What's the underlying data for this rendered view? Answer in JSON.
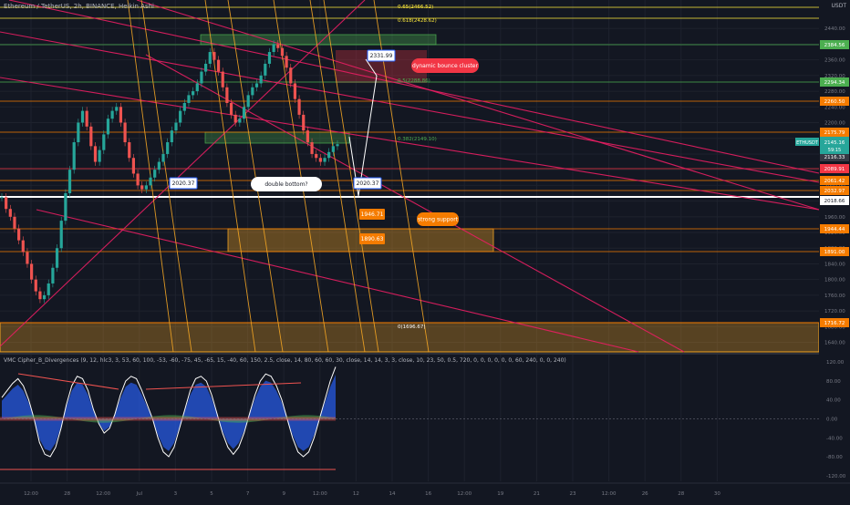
{
  "header": {
    "symbol_line": "Ethereum / TetherUS, 2h, BINANCE, Heikin Ashi",
    "currency": "USDT"
  },
  "indicator": {
    "title": "VMC Cipher_B_Divergences (9, 12, hlc3, 3, 53, 60, 100, -53, -60, -75, 45, -65, 15, -40, 60, 150, 2.5, close, 14, 80, 60, 60, 30, close, 14, 14, 3, 3, close, 10, 23, 50, 0.5, 720, 0, 0, 0, 0, 0, 0, 60, 240, 0, 0, 240)"
  },
  "chart_data": {
    "type": "candlestick",
    "price_axis": {
      "range": [
        1625,
        2480
      ],
      "ticks": [
        "2440.00",
        "2400.00",
        "2360.00",
        "2320.00",
        "2280.00",
        "2240.00",
        "2200.00",
        "2160.00",
        "2120.00",
        "2080.00",
        "2040.00",
        "2000.00",
        "1960.00",
        "1920.00",
        "1880.00",
        "1840.00",
        "1800.00",
        "1760.00",
        "1720.00",
        "1680.00",
        "1640.00"
      ]
    },
    "time_axis_labels": [
      "12:00",
      "28",
      "12:00",
      "Jul",
      "3",
      "5",
      "7",
      "9",
      "12:00",
      "12",
      "14",
      "16",
      "12:00",
      "19",
      "21",
      "23",
      "12:00",
      "26",
      "28",
      "30"
    ],
    "price_labels": [
      {
        "text": "2384.56",
        "color": "#4caf50"
      },
      {
        "text": "2294.34",
        "color": "#4caf50"
      },
      {
        "text": "2260.50",
        "color": "#f57c00"
      },
      {
        "text": "2175.79",
        "color": "#f57c00"
      },
      {
        "text": "2116.33",
        "color": "#363a45"
      },
      {
        "text": "2089.91",
        "color": "#f23645"
      },
      {
        "text": "2061.42",
        "color": "#f57c00"
      },
      {
        "text": "2032.97",
        "color": "#f57c00"
      },
      {
        "text": "2018.66",
        "color": "#ffffff"
      },
      {
        "text": "1944.44",
        "color": "#f57c00"
      },
      {
        "text": "1891.00",
        "color": "#f57c00"
      },
      {
        "text": "1716.72",
        "color": "#f57c00"
      }
    ],
    "current_price": {
      "symbol": "ETHUSDT",
      "price": "2145.16",
      "countdown": "59:15"
    },
    "fib_levels": [
      {
        "label": "0.65(2466.52)"
      },
      {
        "label": "0.618(2428.62)"
      },
      {
        "label": "0.5(2288.86)"
      },
      {
        "label": "0.382(2149.10)"
      },
      {
        "label": "0(1696.67)"
      }
    ],
    "callouts": [
      {
        "text": "2331.99"
      },
      {
        "text": "dynamic bounce cluster"
      },
      {
        "text": "2020.37"
      },
      {
        "text": "double bottom?"
      },
      {
        "text": "2020.37"
      },
      {
        "text": "1946.71"
      },
      {
        "text": "strong support"
      },
      {
        "text": "1890.63"
      }
    ],
    "candles_close_path": [
      2010,
      1980,
      1960,
      1930,
      1900,
      1870,
      1840,
      1800,
      1770,
      1750,
      1760,
      1790,
      1830,
      1880,
      1950,
      2020,
      2080,
      2150,
      2200,
      2230,
      2190,
      2140,
      2100,
      2130,
      2170,
      2210,
      2230,
      2240,
      2200,
      2150,
      2110,
      2070,
      2040,
      2030,
      2040,
      2060,
      2080,
      2100,
      2120,
      2150,
      2180,
      2200,
      2230,
      2250,
      2270,
      2280,
      2300,
      2330,
      2350,
      2380,
      2360,
      2330,
      2290,
      2250,
      2220,
      2200,
      2210,
      2240,
      2270,
      2290,
      2300,
      2320,
      2350,
      2380,
      2400,
      2390,
      2370,
      2340,
      2300,
      2260,
      2220,
      2180,
      2150,
      2120,
      2110,
      2100,
      2110,
      2125,
      2140,
      2145
    ],
    "indicator_axis": {
      "range": [
        -130,
        130
      ],
      "ticks": [
        "120.00",
        "80.00",
        "40.00",
        "0.00",
        "-40.00",
        "-80.00",
        "-120.00"
      ]
    },
    "wave_path": [
      45,
      60,
      75,
      85,
      70,
      40,
      0,
      -50,
      -75,
      -80,
      -60,
      -20,
      30,
      70,
      90,
      85,
      60,
      20,
      -10,
      -30,
      -20,
      10,
      50,
      80,
      90,
      85,
      60,
      30,
      0,
      -40,
      -70,
      -80,
      -60,
      -20,
      20,
      60,
      85,
      90,
      80,
      50,
      10,
      -30,
      -60,
      -75,
      -60,
      -30,
      10,
      50,
      80,
      95,
      90,
      70,
      40,
      0,
      -40,
      -70,
      -80,
      -70,
      -40,
      0,
      40,
      80,
      110
    ]
  }
}
